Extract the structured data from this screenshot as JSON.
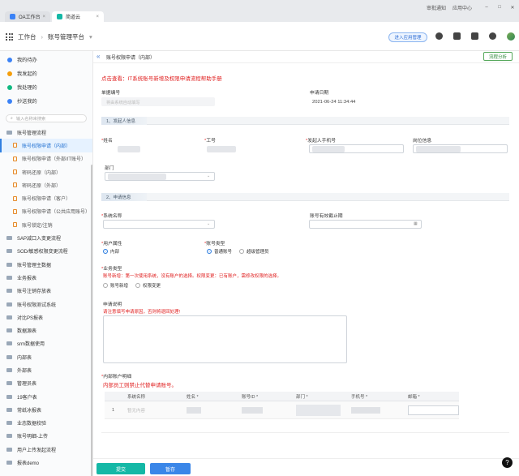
{
  "browser": {
    "tabs": [
      {
        "label": "OA工作台"
      },
      {
        "label": "简道云"
      }
    ],
    "right": {
      "approval": "审批通知",
      "center": "应用中心"
    }
  },
  "header": {
    "workspace": "工作台",
    "platform": "账号管理平台",
    "enter_btn": "进入应用管理"
  },
  "sidebar": {
    "nav": [
      {
        "label": "我的待办",
        "color": "#3b82f6"
      },
      {
        "label": "我发起的",
        "color": "#f59e0b"
      },
      {
        "label": "我处理的",
        "color": "#10b981"
      },
      {
        "label": "抄送我的",
        "color": "#3b82f6"
      }
    ],
    "search_placeholder": "输入名称来搜索",
    "group": "账号管理流程",
    "children": [
      "账号权限申请（内部）",
      "账号权限申请（外部/IT账号）",
      "密码还原（内部）",
      "密码还原（外部）",
      "账号权限申请（客户）",
      "账号权限申请（公共应用账号）",
      "账号锁定/注销"
    ],
    "folders": [
      "SAP减口入变更流程",
      "SOD/敏感权限变更流程",
      "账号管理主数据",
      "业务报表",
      "账号注销存放表",
      "账号权限测试系统",
      "对比PS报表",
      "数据源表",
      "srm数据使用",
      "内部表",
      "外部表",
      "管理员表",
      "19客户表",
      "常纸冰报表",
      "业态数据校验",
      "账号明细-上传",
      "用户上传发起流程",
      "报表demo"
    ]
  },
  "main": {
    "title": "账号权限申请（内部）",
    "flow_btn": "流程分析",
    "help_link": "点击查看：IT系统账号新增及权限申请流程帮助手册",
    "doc_no_label": "单据编号",
    "doc_no_placeholder": "将由系统自动填写",
    "apply_date_label": "申请日期",
    "apply_date_value": "2021-06-24 11:34:44",
    "section1": "1、发起人信息",
    "name_label": "姓名",
    "empno_label": "工号",
    "phone_label": "发起人手机号",
    "post_label": "岗位信息",
    "dept_label": "部门",
    "section2": "2、申请信息",
    "system_label": "系统名称",
    "expire_label": "账号有效截止期",
    "user_attr_label": "用户属性",
    "user_attr_option": "内部",
    "acct_type_label": "账号类型",
    "acct_type_options": [
      "普通账号",
      "超级管理员"
    ],
    "biz_type_label": "业务类型",
    "biz_type_note": "账号新增：第一次使用系统，没有账户的选择。权限变更：已有账户，需修改权限的选择。",
    "biz_type_options": [
      "账号新增",
      "权限变更"
    ],
    "reason_label": "申请说明",
    "reason_hint": "请注意填写申请原因，否则将退回处理!",
    "detail_label": "内部账户明细",
    "detail_warning": "内部员工则禁止代替申请账号。",
    "table_headers": [
      "系统名称",
      "姓名 *",
      "账号ID *",
      "部门 *",
      "手机号 *",
      "邮箱 *"
    ],
    "table_row": {
      "index": "1",
      "system": "暂无内容"
    },
    "submit": "提交",
    "save": "暂存"
  },
  "help_btn": "?"
}
